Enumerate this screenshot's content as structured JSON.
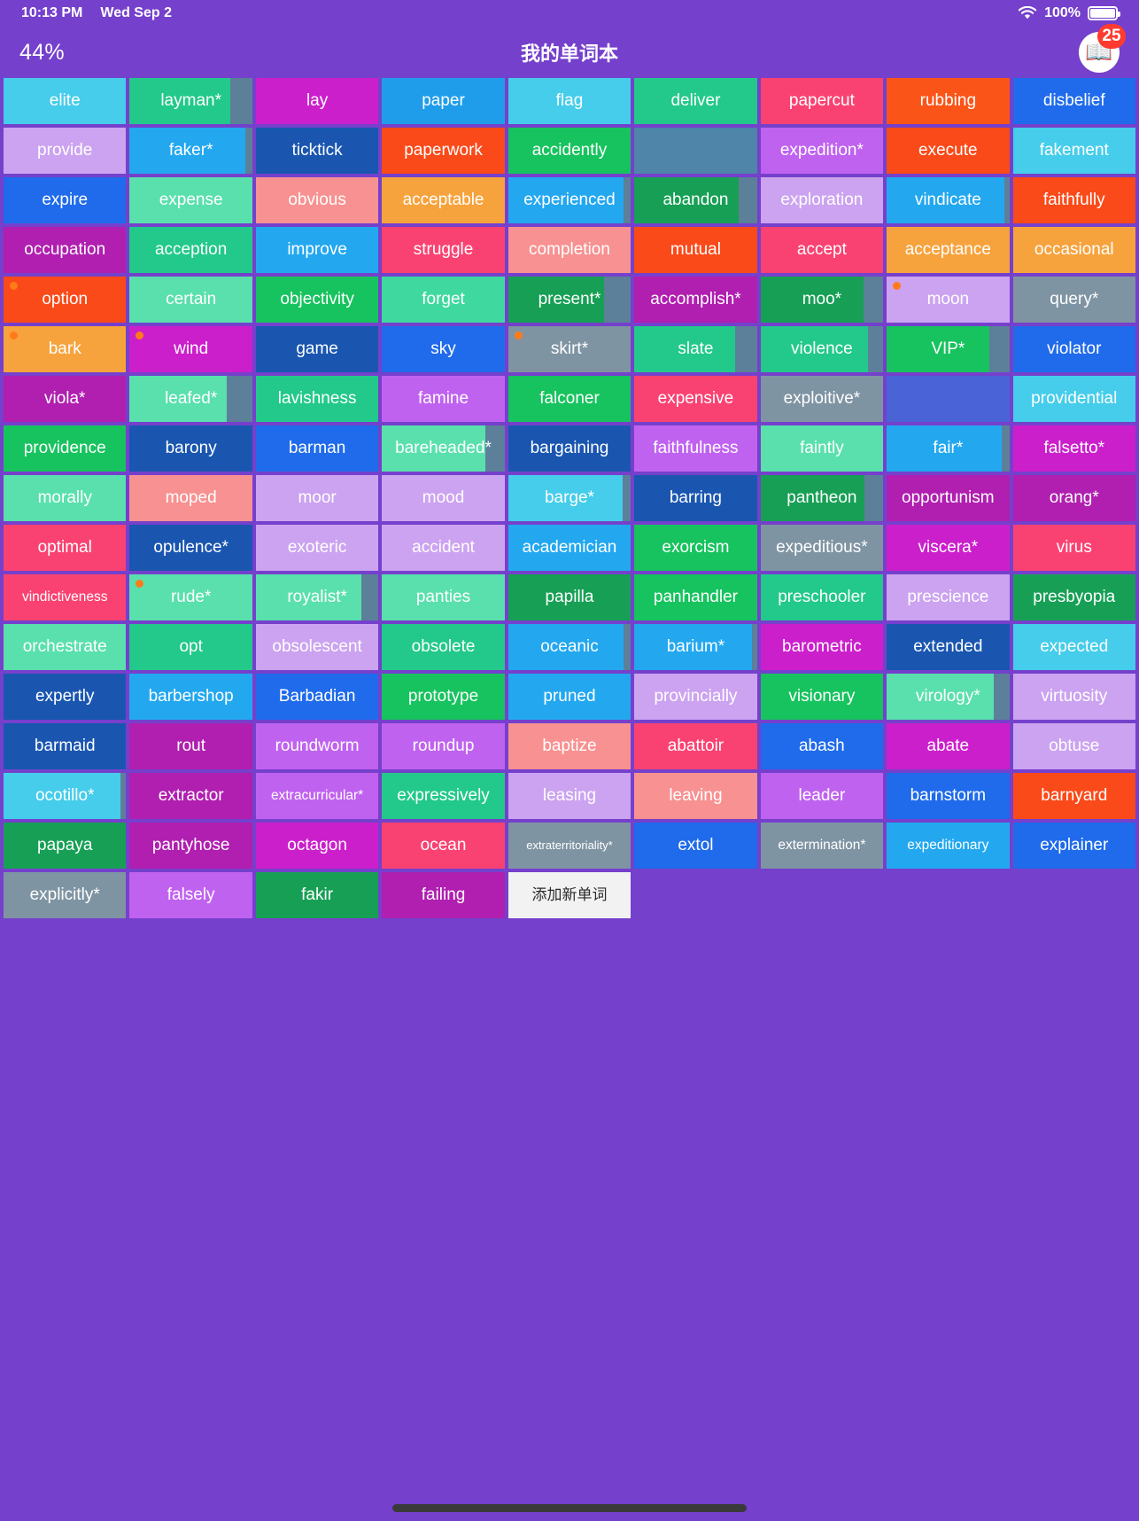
{
  "theme": {
    "background": "#7540CC",
    "progress_overlay": "#5C8099",
    "dot_color": "#FF7A1A",
    "badge_color": "#FF3B30"
  },
  "status_bar": {
    "time": "10:13 PM",
    "date": "Wed Sep 2",
    "wifi_icon": "wifi-icon",
    "battery_percent": "100%",
    "battery_icon": "battery-icon"
  },
  "header": {
    "progress": "44%",
    "title": "我的单词本",
    "book_icon": "📖",
    "badge_count": "25"
  },
  "footer": {
    "home_indicator": "home-indicator"
  },
  "add_button": {
    "label": "添加新单词"
  },
  "tiles": [
    {
      "label": "elite",
      "color": "#45CDEB"
    },
    {
      "label": "layman*",
      "color": "#22C98A",
      "progress": 82
    },
    {
      "label": "lay",
      "color": "#CC1FCC"
    },
    {
      "label": "paper",
      "color": "#1F9DEB"
    },
    {
      "label": "flag",
      "color": "#45CDEB"
    },
    {
      "label": "deliver",
      "color": "#22C98A"
    },
    {
      "label": "papercut",
      "color": "#FA4272"
    },
    {
      "label": "rubbing",
      "color": "#FA5419"
    },
    {
      "label": "disbelief",
      "color": "#1F6BEB"
    },
    {
      "label": "provide",
      "color": "#CCA3F0"
    },
    {
      "label": "faker*",
      "color": "#23A8F0",
      "progress": 94
    },
    {
      "label": "ticktick",
      "color": "#1A56B0"
    },
    {
      "label": "paperwork",
      "color": "#FA4A19"
    },
    {
      "label": "accidently",
      "color": "#17C35E"
    },
    {
      "label": "",
      "color": "#4E85A8"
    },
    {
      "label": "expedition*",
      "color": "#C062F0"
    },
    {
      "label": "execute",
      "color": "#FA4A19"
    },
    {
      "label": "fakement",
      "color": "#45CDEB"
    },
    {
      "label": "expire",
      "color": "#1F6BEB"
    },
    {
      "label": "expense",
      "color": "#59E0AD"
    },
    {
      "label": "obvious",
      "color": "#F89191"
    },
    {
      "label": "acceptable",
      "color": "#F7A33D"
    },
    {
      "label": "experienced",
      "color": "#23A8F0",
      "progress": 94
    },
    {
      "label": "abandon",
      "color": "#17A055",
      "progress": 85
    },
    {
      "label": "exploration",
      "color": "#CCA3F0"
    },
    {
      "label": "vindicate",
      "color": "#23A8F0",
      "progress": 96
    },
    {
      "label": "faithfully",
      "color": "#FA4A19"
    },
    {
      "label": "occupation",
      "color": "#B01FB0"
    },
    {
      "label": "acception",
      "color": "#22C98A"
    },
    {
      "label": "improve",
      "color": "#23A8F0"
    },
    {
      "label": "struggle",
      "color": "#FA4272"
    },
    {
      "label": "completion",
      "color": "#F89191"
    },
    {
      "label": "mutual",
      "color": "#FA4A19"
    },
    {
      "label": "accept",
      "color": "#FA4272"
    },
    {
      "label": "acceptance",
      "color": "#F7A33D"
    },
    {
      "label": "occasional",
      "color": "#F7A33D"
    },
    {
      "label": "option",
      "color": "#FA4A19",
      "dot": true
    },
    {
      "label": "certain",
      "color": "#59E0AD"
    },
    {
      "label": "objectivity",
      "color": "#17C35E"
    },
    {
      "label": "forget",
      "color": "#3FD9A0"
    },
    {
      "label": "present*",
      "color": "#17A055",
      "progress": 78
    },
    {
      "label": "accomplish*",
      "color": "#B01FB0"
    },
    {
      "label": "moo*",
      "color": "#17A055",
      "progress": 84
    },
    {
      "label": "moon",
      "color": "#CCA3F0",
      "dot": true
    },
    {
      "label": "query*",
      "color": "#7F94A3"
    },
    {
      "label": "bark",
      "color": "#F7A33D",
      "dot": true
    },
    {
      "label": "wind",
      "color": "#CC1FCC",
      "dot": true
    },
    {
      "label": "game",
      "color": "#1A56B0"
    },
    {
      "label": "sky",
      "color": "#1F6BEB"
    },
    {
      "label": "skirt*",
      "color": "#7F94A3",
      "dot": true
    },
    {
      "label": "slate",
      "color": "#22C98A",
      "progress": 82
    },
    {
      "label": "violence",
      "color": "#22C98A",
      "progress": 88
    },
    {
      "label": "VIP*",
      "color": "#17C35E",
      "progress": 84
    },
    {
      "label": "violator",
      "color": "#1F6BEB"
    },
    {
      "label": "viola*",
      "color": "#B01FB0"
    },
    {
      "label": "leafed*",
      "color": "#59E0AD",
      "progress": 79
    },
    {
      "label": "lavishness",
      "color": "#22C98A"
    },
    {
      "label": "famine",
      "color": "#C062F0"
    },
    {
      "label": "falconer",
      "color": "#17C35E"
    },
    {
      "label": "expensive",
      "color": "#FA4272"
    },
    {
      "label": "exploitive*",
      "color": "#7F94A3"
    },
    {
      "label": "",
      "color": "#4A63D6"
    },
    {
      "label": "providential",
      "color": "#45CDEB"
    },
    {
      "label": "providence",
      "color": "#17C35E"
    },
    {
      "label": "barony",
      "color": "#1A56B0"
    },
    {
      "label": "barman",
      "color": "#1F6BEB"
    },
    {
      "label": "bareheaded*",
      "color": "#59E0AD",
      "progress": 84
    },
    {
      "label": "bargaining",
      "color": "#1A56B0"
    },
    {
      "label": "faithfulness",
      "color": "#C062F0"
    },
    {
      "label": "faintly",
      "color": "#59E0AD"
    },
    {
      "label": "fair*",
      "color": "#23A8F0",
      "progress": 94
    },
    {
      "label": "falsetto*",
      "color": "#CC1FCC"
    },
    {
      "label": "morally",
      "color": "#59E0AD"
    },
    {
      "label": "moped",
      "color": "#F89191"
    },
    {
      "label": "moor",
      "color": "#CCA3F0"
    },
    {
      "label": "mood",
      "color": "#CCA3F0"
    },
    {
      "label": "barge*",
      "color": "#45CDEB",
      "progress": 93
    },
    {
      "label": "barring",
      "color": "#1A56B0"
    },
    {
      "label": "pantheon",
      "color": "#17A055",
      "progress": 85
    },
    {
      "label": "opportunism",
      "color": "#B01FB0"
    },
    {
      "label": "orang*",
      "color": "#B01FB0"
    },
    {
      "label": "optimal",
      "color": "#FA4272"
    },
    {
      "label": "opulence*",
      "color": "#1A56B0"
    },
    {
      "label": "exoteric",
      "color": "#CCA3F0"
    },
    {
      "label": "accident",
      "color": "#CCA3F0"
    },
    {
      "label": "academician",
      "color": "#23A8F0"
    },
    {
      "label": "exorcism",
      "color": "#17C35E"
    },
    {
      "label": "expeditious*",
      "color": "#7F94A3"
    },
    {
      "label": "viscera*",
      "color": "#CC1FCC"
    },
    {
      "label": "virus",
      "color": "#FA4272"
    },
    {
      "label": "vindictiveness",
      "color": "#FA4272"
    },
    {
      "label": "rude*",
      "color": "#59E0AD",
      "dot": true
    },
    {
      "label": "royalist*",
      "color": "#59E0AD",
      "progress": 86
    },
    {
      "label": "panties",
      "color": "#59E0AD"
    },
    {
      "label": "papilla",
      "color": "#17A055"
    },
    {
      "label": "panhandler",
      "color": "#17C35E"
    },
    {
      "label": "preschooler",
      "color": "#22C98A"
    },
    {
      "label": "prescience",
      "color": "#CCA3F0"
    },
    {
      "label": "presbyopia",
      "color": "#17A055"
    },
    {
      "label": "orchestrate",
      "color": "#59E0AD"
    },
    {
      "label": "opt",
      "color": "#22C98A"
    },
    {
      "label": "obsolescent",
      "color": "#CCA3F0"
    },
    {
      "label": "obsolete",
      "color": "#22C98A"
    },
    {
      "label": "oceanic",
      "color": "#23A8F0",
      "progress": 94
    },
    {
      "label": "barium*",
      "color": "#23A8F0",
      "progress": 96
    },
    {
      "label": "barometric",
      "color": "#CC1FCC"
    },
    {
      "label": "extended",
      "color": "#1A56B0"
    },
    {
      "label": "expected",
      "color": "#45CDEB"
    },
    {
      "label": "expertly",
      "color": "#1A56B0"
    },
    {
      "label": "barbershop",
      "color": "#23A8F0"
    },
    {
      "label": "Barbadian",
      "color": "#1F6BEB"
    },
    {
      "label": "prototype",
      "color": "#17C35E"
    },
    {
      "label": "pruned",
      "color": "#23A8F0"
    },
    {
      "label": "provincially",
      "color": "#CCA3F0"
    },
    {
      "label": "visionary",
      "color": "#17C35E"
    },
    {
      "label": "virology*",
      "color": "#59E0AD",
      "progress": 87
    },
    {
      "label": "virtuosity",
      "color": "#CCA3F0"
    },
    {
      "label": "barmaid",
      "color": "#1A56B0"
    },
    {
      "label": "rout",
      "color": "#B01FB0"
    },
    {
      "label": "roundworm",
      "color": "#C062F0"
    },
    {
      "label": "roundup",
      "color": "#C062F0"
    },
    {
      "label": "baptize",
      "color": "#F89191"
    },
    {
      "label": "abattoir",
      "color": "#FA4272"
    },
    {
      "label": "abash",
      "color": "#1F6BEB"
    },
    {
      "label": "abate",
      "color": "#CC1FCC"
    },
    {
      "label": "obtuse",
      "color": "#CCA3F0"
    },
    {
      "label": "ocotillo*",
      "color": "#45CDEB",
      "progress": 95
    },
    {
      "label": "extractor",
      "color": "#B01FB0"
    },
    {
      "label": "extracurricular*",
      "color": "#C062F0"
    },
    {
      "label": "expressively",
      "color": "#22C98A"
    },
    {
      "label": "leasing",
      "color": "#CCA3F0"
    },
    {
      "label": "leaving",
      "color": "#F89191"
    },
    {
      "label": "leader",
      "color": "#C062F0"
    },
    {
      "label": "barnstorm",
      "color": "#1F6BEB"
    },
    {
      "label": "barnyard",
      "color": "#FA4A19"
    },
    {
      "label": "papaya",
      "color": "#17A055"
    },
    {
      "label": "pantyhose",
      "color": "#B01FB0"
    },
    {
      "label": "octagon",
      "color": "#CC1FCC"
    },
    {
      "label": "ocean",
      "color": "#FA4272"
    },
    {
      "label": "extraterritoriality*",
      "color": "#7F94A3"
    },
    {
      "label": "extol",
      "color": "#1F6BEB"
    },
    {
      "label": "extermination*",
      "color": "#7F94A3"
    },
    {
      "label": "expeditionary",
      "color": "#23A8F0"
    },
    {
      "label": "explainer",
      "color": "#1F6BEB"
    },
    {
      "label": "explicitly*",
      "color": "#7F94A3"
    },
    {
      "label": "falsely",
      "color": "#C062F0"
    },
    {
      "label": "fakir",
      "color": "#17A055"
    },
    {
      "label": "failing",
      "color": "#B01FB0"
    }
  ]
}
